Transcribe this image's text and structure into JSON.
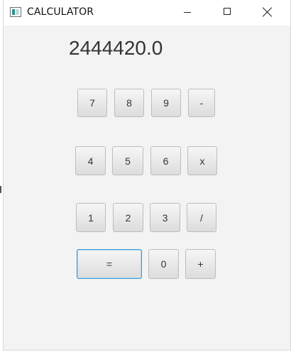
{
  "window": {
    "title": "CALCULATOR",
    "icons": {
      "app": "calculator-app-icon",
      "minimize": "minimize-icon",
      "maximize": "maximize-icon",
      "close": "close-icon"
    }
  },
  "display": {
    "value": "2444420.0"
  },
  "keys": {
    "k7": "7",
    "k8": "8",
    "k9": "9",
    "minus": "-",
    "k4": "4",
    "k5": "5",
    "k6": "6",
    "multiply": "x",
    "k1": "1",
    "k2": "2",
    "k3": "3",
    "divide": "/",
    "equals": "=",
    "k0": "0",
    "plus": "+"
  },
  "colors": {
    "focus_border": "#3c9ad6",
    "window_background": "#f3f3f3",
    "titlebar_background": "#ffffff"
  }
}
